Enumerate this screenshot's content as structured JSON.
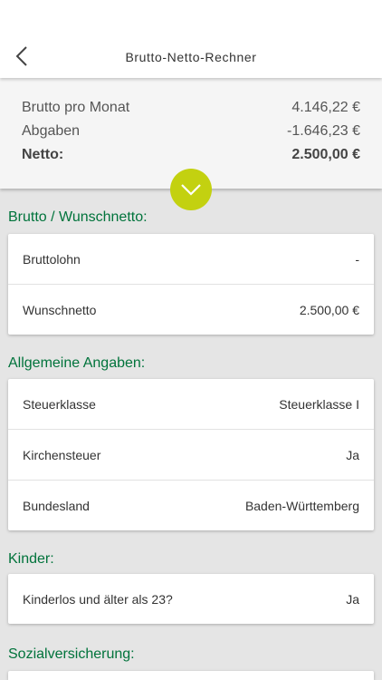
{
  "header": {
    "title": "Brutto-Netto-Rechner",
    "back_icon": "chevron-left-icon"
  },
  "summary": {
    "rows": [
      {
        "label": "Brutto pro Monat",
        "value": "4.146,22 €"
      },
      {
        "label": "Abgaben",
        "value": "-1.646,23 €"
      },
      {
        "label": "Netto:",
        "value": "2.500,00 €"
      }
    ],
    "toggle_icon": "chevron-down-icon"
  },
  "sections": [
    {
      "title": "Brutto / Wunschnetto:",
      "rows": [
        {
          "label": "Bruttolohn",
          "value": "-"
        },
        {
          "label": "Wunschnetto",
          "value": "2.500,00 €"
        }
      ]
    },
    {
      "title": "Allgemeine Angaben:",
      "rows": [
        {
          "label": "Steuerklasse",
          "value": "Steuerklasse I"
        },
        {
          "label": "Kirchensteuer",
          "value": "Ja"
        },
        {
          "label": "Bundesland",
          "value": "Baden-Württemberg"
        }
      ]
    },
    {
      "title": "Kinder:",
      "rows": [
        {
          "label": "Kinderlos und älter als 23?",
          "value": "Ja"
        }
      ]
    },
    {
      "title": "Sozialversicherung:",
      "rows": []
    }
  ],
  "colors": {
    "accent_green": "#00733b",
    "toggle_lime": "#c3d110",
    "background": "#e5e5e5"
  }
}
